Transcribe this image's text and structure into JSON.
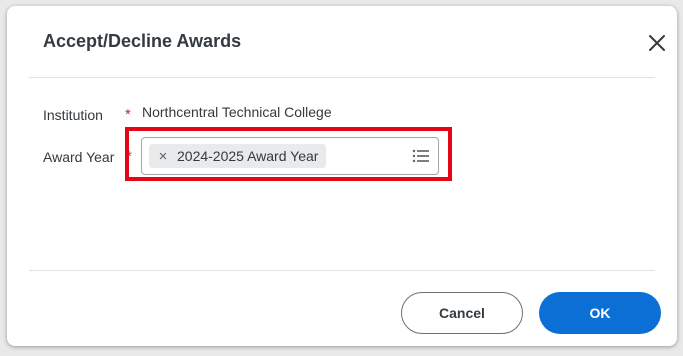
{
  "dialog": {
    "title": "Accept/Decline Awards",
    "close_icon": "close-icon"
  },
  "form": {
    "institution": {
      "label": "Institution",
      "required_marker": "*",
      "value": "Northcentral Technical College"
    },
    "award_year": {
      "label": "Award Year",
      "required_marker": "*",
      "selected": "2024-2025 Award Year",
      "remove_icon": "×",
      "list_icon": "list-icon"
    }
  },
  "footer": {
    "cancel_label": "Cancel",
    "ok_label": "OK"
  },
  "colors": {
    "accent": "#0b6fd6",
    "required": "#d1242f",
    "highlight_box": "#e40613"
  }
}
